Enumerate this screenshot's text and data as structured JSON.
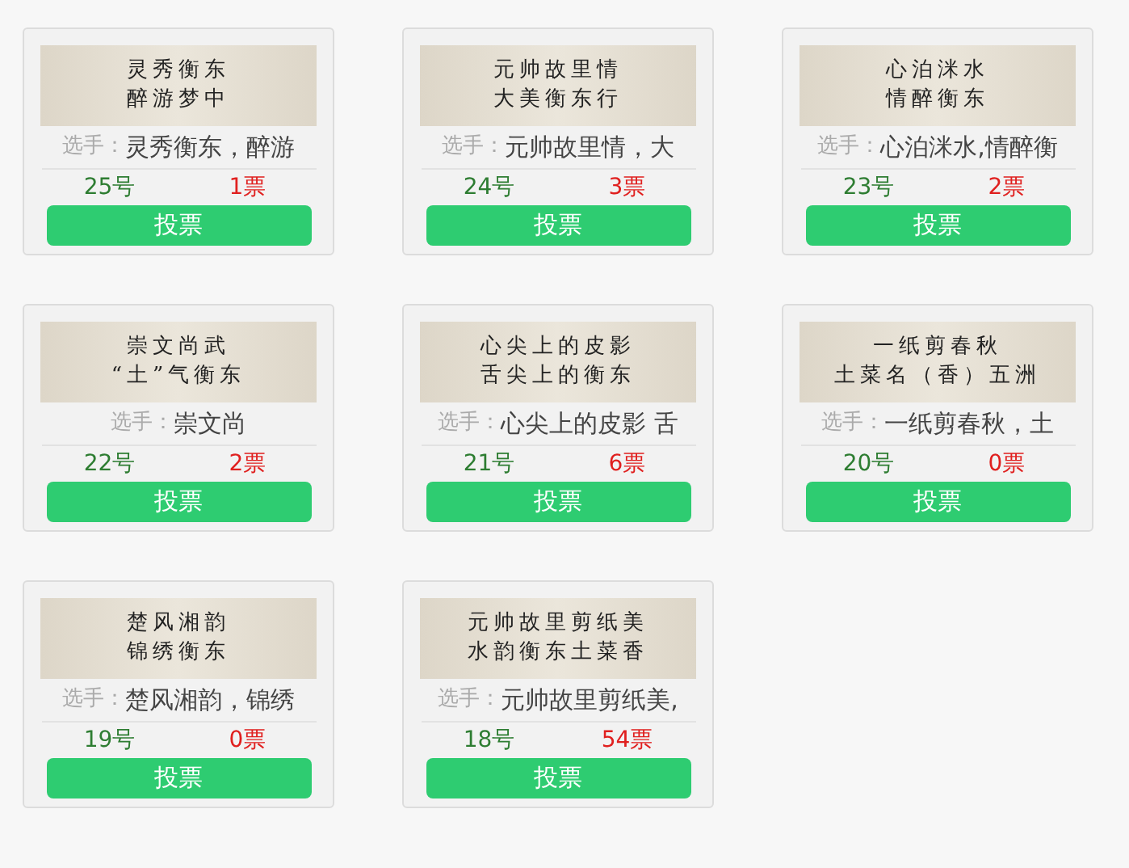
{
  "entries": [
    {
      "title_lines": [
        "灵秀衡东",
        "醉游梦中"
      ],
      "label": "选手：",
      "name": "灵秀衡东，醉游",
      "number": "25号",
      "votes": "1票",
      "button": "投票"
    },
    {
      "title_lines": [
        "元帅故里情",
        "大美衡东行"
      ],
      "label": "选手：",
      "name": "元帅故里情，大",
      "number": "24号",
      "votes": "3票",
      "button": "投票"
    },
    {
      "title_lines": [
        "心泊洣水",
        "情醉衡东"
      ],
      "label": "选手：",
      "name": "心泊洣水,情醉衡",
      "number": "23号",
      "votes": "2票",
      "button": "投票"
    },
    {
      "title_lines": [
        "崇文尚武",
        "“土”气衡东"
      ],
      "label": "选手：",
      "name": "崇文尚",
      "number": "22号",
      "votes": "2票",
      "button": "投票"
    },
    {
      "title_lines": [
        "心尖上的皮影",
        "舌尖上的衡东"
      ],
      "label": "选手：",
      "name": "心尖上的皮影 舌",
      "number": "21号",
      "votes": "6票",
      "button": "投票"
    },
    {
      "title_lines": [
        "一纸剪春秋",
        "土菜名（香）五洲"
      ],
      "label": "选手：",
      "name": "一纸剪春秋，土",
      "number": "20号",
      "votes": "0票",
      "button": "投票"
    },
    {
      "title_lines": [
        "楚风湘韵",
        "锦绣衡东"
      ],
      "label": "选手：",
      "name": "楚风湘韵，锦绣",
      "number": "19号",
      "votes": "0票",
      "button": "投票"
    },
    {
      "title_lines": [
        "元帅故里剪纸美",
        "水韵衡东土菜香"
      ],
      "label": "选手：",
      "name": "元帅故里剪纸美,",
      "number": "18号",
      "votes": "54票",
      "button": "投票"
    }
  ]
}
